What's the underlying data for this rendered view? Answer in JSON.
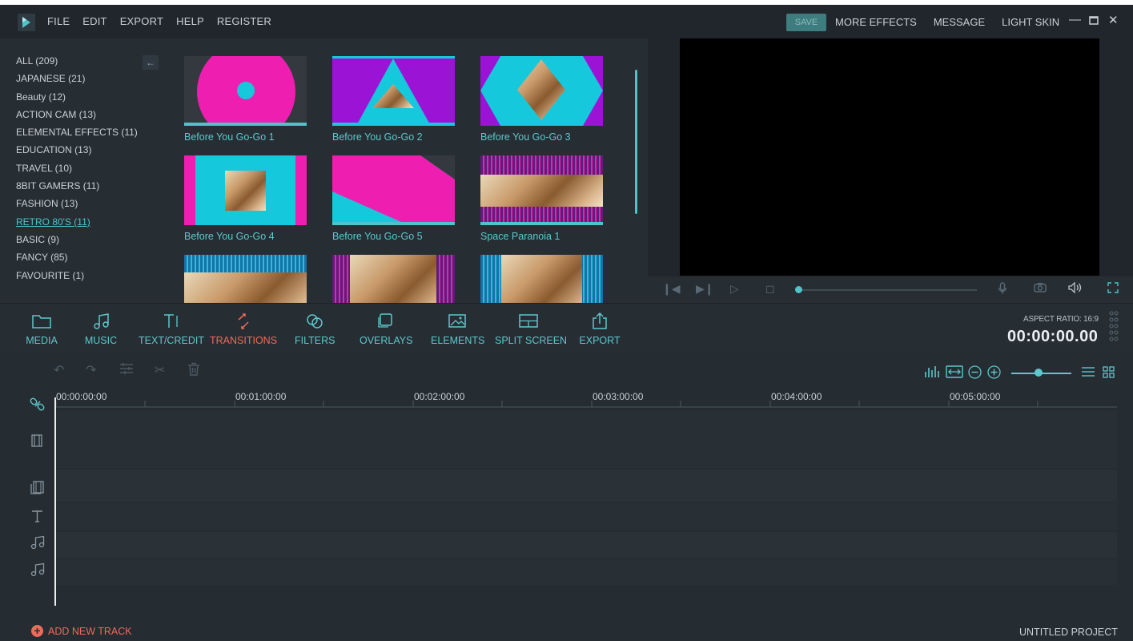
{
  "menu": {
    "left": [
      "FILE",
      "EDIT",
      "EXPORT",
      "HELP",
      "REGISTER"
    ],
    "save": "SAVE",
    "right": [
      "MORE EFFECTS",
      "MESSAGE",
      "LIGHT SKIN"
    ]
  },
  "categories": [
    {
      "label": "ALL (209)",
      "active": false
    },
    {
      "label": "JAPANESE (21)",
      "active": false
    },
    {
      "label": "Beauty (12)",
      "active": false
    },
    {
      "label": "ACTION CAM (13)",
      "active": false
    },
    {
      "label": "ELEMENTAL EFFECTS (11)",
      "active": false
    },
    {
      "label": "EDUCATION (13)",
      "active": false
    },
    {
      "label": "TRAVEL (10)",
      "active": false
    },
    {
      "label": "8BIT GAMERS (11)",
      "active": false
    },
    {
      "label": "FASHION (13)",
      "active": false
    },
    {
      "label": "RETRO 80'S (11)",
      "active": true
    },
    {
      "label": "BASIC (9)",
      "active": false
    },
    {
      "label": "FANCY (85)",
      "active": false
    },
    {
      "label": "FAVOURITE (1)",
      "active": false
    }
  ],
  "transitions": [
    {
      "label": "Before You Go-Go 1"
    },
    {
      "label": "Before You Go-Go 2"
    },
    {
      "label": "Before You Go-Go 3"
    },
    {
      "label": "Before You Go-Go 4"
    },
    {
      "label": "Before You Go-Go 5"
    },
    {
      "label": "Space Paranoia 1"
    }
  ],
  "toolbar": {
    "items": [
      "MEDIA",
      "MUSIC",
      "TEXT/CREDIT",
      "TRANSITIONS",
      "FILTERS",
      "OVERLAYS",
      "ELEMENTS",
      "SPLIT SCREEN",
      "EXPORT"
    ],
    "active": "TRANSITIONS",
    "aspect_ratio": "ASPECT RATIO: 16:9",
    "timecode": "00:00:00.00"
  },
  "timeline": {
    "ruler": [
      "00:00:00:00",
      "00:01:00:00",
      "00:02:00:00",
      "00:03:00:00",
      "00:04:00:00",
      "00:05:00:00"
    ],
    "add_track": "ADD NEW TRACK",
    "project_name": "UNTITLED PROJECT"
  },
  "colors": {
    "accent": "#4fc3c9",
    "active_tab": "#f06a5a",
    "magenta": "#ee1fb0",
    "cyan": "#15c8dc",
    "purple": "#9b14d6"
  },
  "icons": {
    "logo": "app-logo",
    "media": "folder-icon",
    "music": "music-note-icon",
    "text": "text-icon",
    "transitions": "transition-arrows-icon",
    "filters": "filter-circles-icon",
    "overlays": "overlay-icon",
    "elements": "image-icon",
    "split_screen": "split-screen-icon",
    "export": "export-icon"
  }
}
